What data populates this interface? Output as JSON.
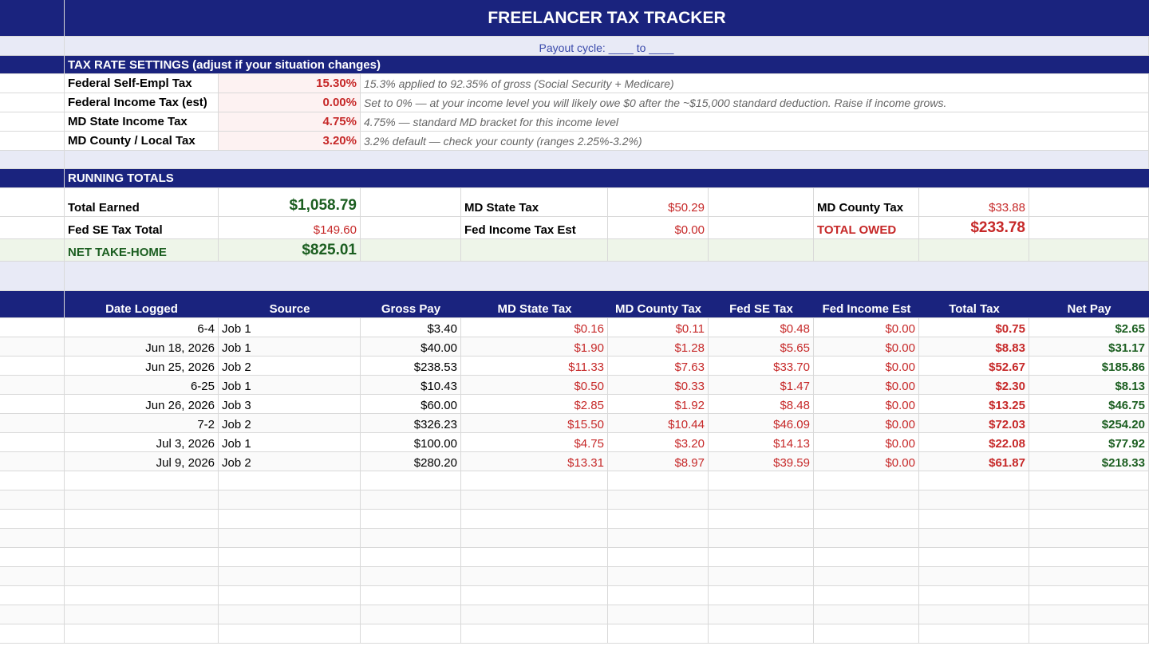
{
  "title": "FREELANCER TAX TRACKER",
  "payout_cycle": "Payout cycle: ____ to ____",
  "rate_settings": {
    "header": "TAX RATE SETTINGS (adjust if your situation changes)",
    "rows": [
      {
        "label": "Federal Self-Empl Tax",
        "rate": "15.30%",
        "note": "15.3% applied to 92.35% of gross (Social Security + Medicare)"
      },
      {
        "label": "Federal Income Tax (est)",
        "rate": "0.00%",
        "note": "Set to 0% — at your income level you will likely owe $0 after the ~$15,000 standard deduction. Raise if income grows."
      },
      {
        "label": "MD State Income Tax",
        "rate": "4.75%",
        "note": "4.75% — standard MD bracket for this income level"
      },
      {
        "label": "MD County / Local Tax",
        "rate": "3.20%",
        "note": "3.2% default — check your county (ranges 2.25%-3.2%)"
      }
    ]
  },
  "running_totals": {
    "header": "RUNNING TOTALS",
    "total_earned_label": "Total Earned",
    "total_earned": "$1,058.79",
    "md_state_label": "MD State Tax",
    "md_state": "$50.29",
    "md_county_label": "MD County Tax",
    "md_county": "$33.88",
    "fed_se_label": "Fed SE Tax Total",
    "fed_se": "$149.60",
    "fed_income_label": "Fed Income Tax Est",
    "fed_income": "$0.00",
    "total_owed_label": "TOTAL OWED",
    "total_owed": "$233.78",
    "net_label": "NET TAKE-HOME",
    "net": "$825.01"
  },
  "log": {
    "columns": [
      "Date Logged",
      "Source",
      "Gross Pay",
      "MD State Tax",
      "MD County Tax",
      "Fed SE Tax",
      "Fed Income Est",
      "Total Tax",
      "Net Pay"
    ],
    "rows": [
      [
        "6-4",
        "Job 1",
        "$3.40",
        "$0.16",
        "$0.11",
        "$0.48",
        "$0.00",
        "$0.75",
        "$2.65"
      ],
      [
        "Jun 18, 2026",
        "Job 1",
        "$40.00",
        "$1.90",
        "$1.28",
        "$5.65",
        "$0.00",
        "$8.83",
        "$31.17"
      ],
      [
        "Jun 25, 2026",
        "Job 2",
        "$238.53",
        "$11.33",
        "$7.63",
        "$33.70",
        "$0.00",
        "$52.67",
        "$185.86"
      ],
      [
        "6-25",
        "Job 1",
        "$10.43",
        "$0.50",
        "$0.33",
        "$1.47",
        "$0.00",
        "$2.30",
        "$8.13"
      ],
      [
        "Jun 26, 2026",
        "Job 3",
        "$60.00",
        "$2.85",
        "$1.92",
        "$8.48",
        "$0.00",
        "$13.25",
        "$46.75"
      ],
      [
        "7-2",
        "Job 2",
        "$326.23",
        "$15.50",
        "$10.44",
        "$46.09",
        "$0.00",
        "$72.03",
        "$254.20"
      ],
      [
        "Jul 3, 2026",
        "Job 1",
        "$100.00",
        "$4.75",
        "$3.20",
        "$14.13",
        "$0.00",
        "$22.08",
        "$77.92"
      ],
      [
        "Jul 9, 2026",
        "Job 2",
        "$280.20",
        "$13.31",
        "$8.97",
        "$39.59",
        "$0.00",
        "$61.87",
        "$218.33"
      ]
    ]
  },
  "colors": {
    "header_bg": "#1a237e",
    "tax_red": "#c62828",
    "net_green": "#1b5e20",
    "band_lavender": "#e8eaf6"
  }
}
